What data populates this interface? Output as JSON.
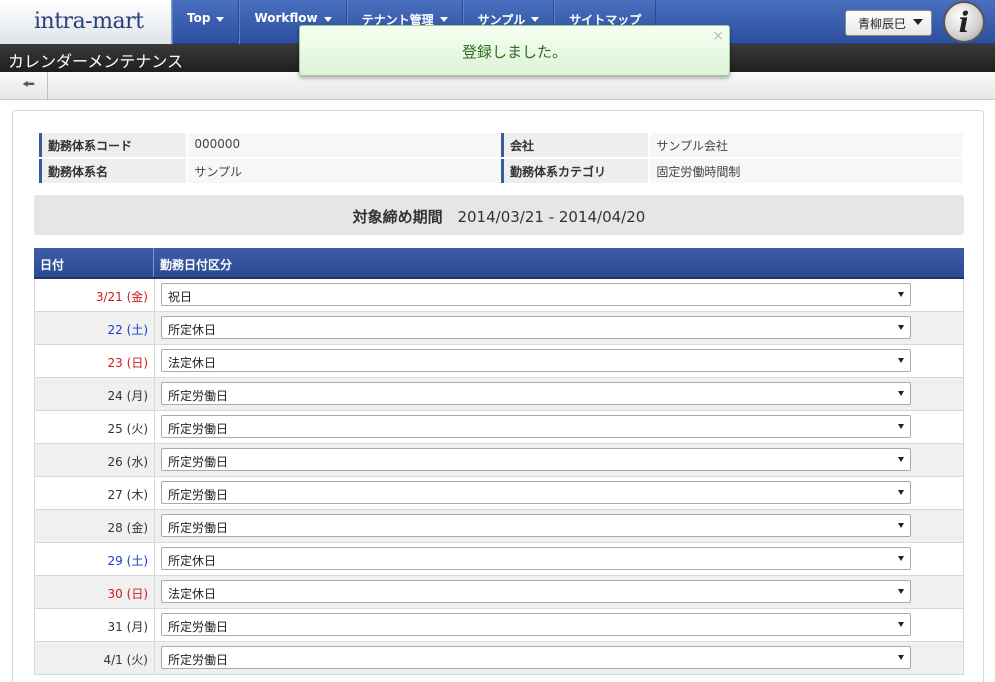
{
  "logo": {
    "text": "intra-mart",
    "mark": "i"
  },
  "nav": {
    "items": [
      {
        "label": "Top"
      },
      {
        "label": "Workflow"
      },
      {
        "label": "テナント管理"
      },
      {
        "label": "サンプル"
      },
      {
        "label": "サイトマップ"
      }
    ],
    "user_name": "青柳辰巳"
  },
  "page": {
    "title": "カレンダーメンテナンス"
  },
  "toast": {
    "message": "登録しました。",
    "close": "×"
  },
  "info": {
    "code_label": "勤務体系コード",
    "code_value": "000000",
    "company_label": "会社",
    "company_value": "サンプル会社",
    "name_label": "勤務体系名",
    "name_value": "サンプル",
    "category_label": "勤務体系カテゴリ",
    "category_value": "固定労働時間制"
  },
  "period": {
    "label": "対象締め期間",
    "value": "2014/03/21 - 2014/04/20"
  },
  "grid": {
    "col_date": "日付",
    "col_type": "勤務日付区分",
    "rows": [
      {
        "date": "3/21 (金)",
        "type": "祝日",
        "color": "#cc1a1a"
      },
      {
        "date": "22 (土)",
        "type": "所定休日",
        "color": "#1a3acc"
      },
      {
        "date": "23 (日)",
        "type": "法定休日",
        "color": "#cc1a1a"
      },
      {
        "date": "24 (月)",
        "type": "所定労働日",
        "color": "#333333"
      },
      {
        "date": "25 (火)",
        "type": "所定労働日",
        "color": "#333333"
      },
      {
        "date": "26 (水)",
        "type": "所定労働日",
        "color": "#333333"
      },
      {
        "date": "27 (木)",
        "type": "所定労働日",
        "color": "#333333"
      },
      {
        "date": "28 (金)",
        "type": "所定労働日",
        "color": "#333333"
      },
      {
        "date": "29 (土)",
        "type": "所定休日",
        "color": "#1a3acc"
      },
      {
        "date": "30 (日)",
        "type": "法定休日",
        "color": "#cc1a1a"
      },
      {
        "date": "31 (月)",
        "type": "所定労働日",
        "color": "#333333"
      },
      {
        "date": "4/1 (火)",
        "type": "所定労働日",
        "color": "#333333"
      }
    ]
  }
}
